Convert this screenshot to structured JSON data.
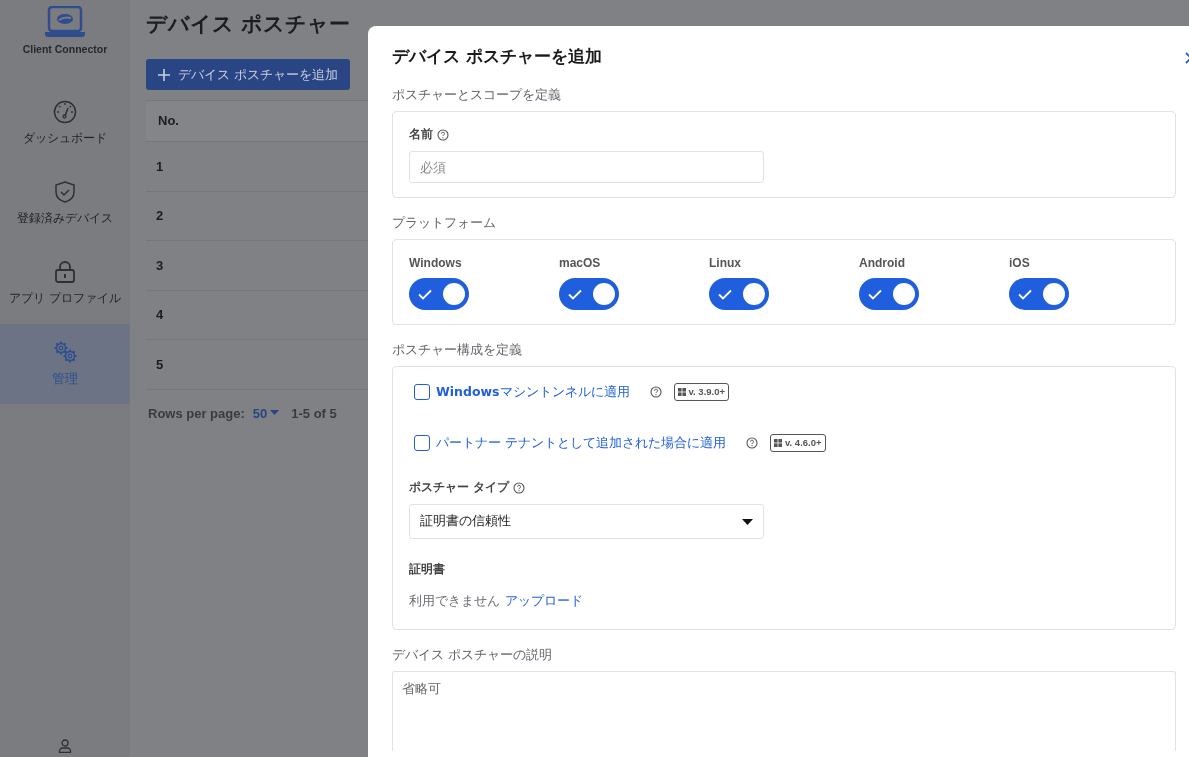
{
  "sidebar": {
    "logo_label": "Client Connector",
    "items": [
      {
        "label": "ダッシュボード",
        "selected": false
      },
      {
        "label": "登録済みデバイス",
        "selected": false
      },
      {
        "label": "アプリ プロファイル",
        "selected": false
      },
      {
        "label": "管理",
        "selected": true
      }
    ]
  },
  "page": {
    "title": "デバイス ポスチャー",
    "add_button": "デバイス ポスチャーを追加",
    "table": {
      "columns": [
        "No."
      ],
      "rows": [
        [
          "1"
        ],
        [
          "2"
        ],
        [
          "3"
        ],
        [
          "4"
        ],
        [
          "5"
        ]
      ]
    },
    "pagination": {
      "rows_per_page_label": "Rows per page:",
      "rows_per_page": "50",
      "range": "1-5 of 5"
    }
  },
  "drawer": {
    "title": "デバイス ポスチャーを追加",
    "scope": {
      "heading": "ポスチャーとスコープを定義",
      "name_label": "名前",
      "placeholder": "必須"
    },
    "platforms": {
      "heading": "プラットフォーム",
      "items": [
        {
          "label": "Windows",
          "on": true
        },
        {
          "label": "macOS",
          "on": true
        },
        {
          "label": "Linux",
          "on": true
        },
        {
          "label": "Android",
          "on": true
        },
        {
          "label": "iOS",
          "on": true
        }
      ]
    },
    "config": {
      "heading": "ポスチャー構成を定義",
      "options": [
        {
          "label": "**Windows**マシントンネルに適用",
          "checked": false,
          "version": "v. 3.9.0+"
        },
        {
          "label": "パートナー テナントとして追加された場合に適用",
          "checked": false,
          "version": "v. 4.6.0+"
        }
      ],
      "type_label": "ポスチャー タイプ",
      "type_value": "証明書の信頼性",
      "certificate_label": "証明書",
      "certificate_status": "利用できません",
      "upload_link": "アップロード"
    },
    "description": {
      "heading": "デバイス ポスチャーの説明",
      "placeholder": "省略可"
    }
  }
}
